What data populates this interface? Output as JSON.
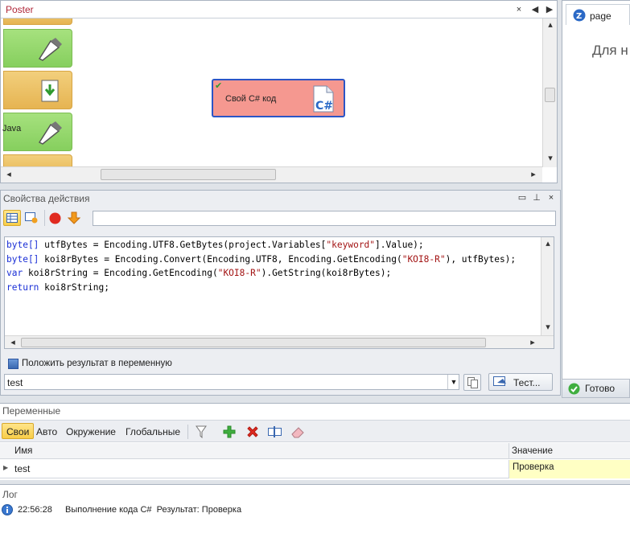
{
  "poster": {
    "tab_title": "Poster",
    "node_label": "Свой C# код",
    "block_label_java": "Java",
    "close_glyph": "×"
  },
  "page_panel": {
    "tab_label": "page",
    "partial_text": "Для н",
    "status": "Готово"
  },
  "props": {
    "title": "Свойства действия",
    "code_lines": [
      [
        {
          "t": "byte[]",
          "c": "kw"
        },
        {
          "t": " utfBytes = Encoding.UTF8.GetBytes(project.Variables["
        },
        {
          "t": "\"keyword\"",
          "c": "str"
        },
        {
          "t": "].Value);"
        }
      ],
      [
        {
          "t": "byte[]",
          "c": "kw"
        },
        {
          "t": " koi8rBytes = Encoding.Convert(Encoding.UTF8, Encoding.GetEncoding("
        },
        {
          "t": "\"KOI8-R\"",
          "c": "str"
        },
        {
          "t": "), utfBytes);"
        }
      ],
      [
        {
          "t": "var",
          "c": "kw"
        },
        {
          "t": " koi8rString = Encoding.GetEncoding("
        },
        {
          "t": "\"KOI8-R\"",
          "c": "str"
        },
        {
          "t": ").GetString(koi8rBytes);"
        }
      ],
      [
        {
          "t": "return",
          "c": "kw"
        },
        {
          "t": " koi8rString;"
        }
      ]
    ],
    "save_result_label": "Положить результат в переменную",
    "result_variable": "test",
    "test_button": "Тест..."
  },
  "vars": {
    "title": "Переменные",
    "tabs": [
      "Свои",
      "Авто",
      "Окружение",
      "Глобальные"
    ],
    "columns": {
      "name": "Имя",
      "value": "Значение"
    },
    "rows": [
      {
        "name": "test",
        "value": "Проверка"
      }
    ]
  },
  "log": {
    "title": "Лог",
    "entries": [
      {
        "time": "22:56:28",
        "message": "Выполнение кода C#  Результат: Проверка"
      }
    ]
  },
  "colors": {
    "accent_blue": "#2b55c6",
    "node_fill": "#f59890",
    "highlight_value": "#ffffc4"
  }
}
